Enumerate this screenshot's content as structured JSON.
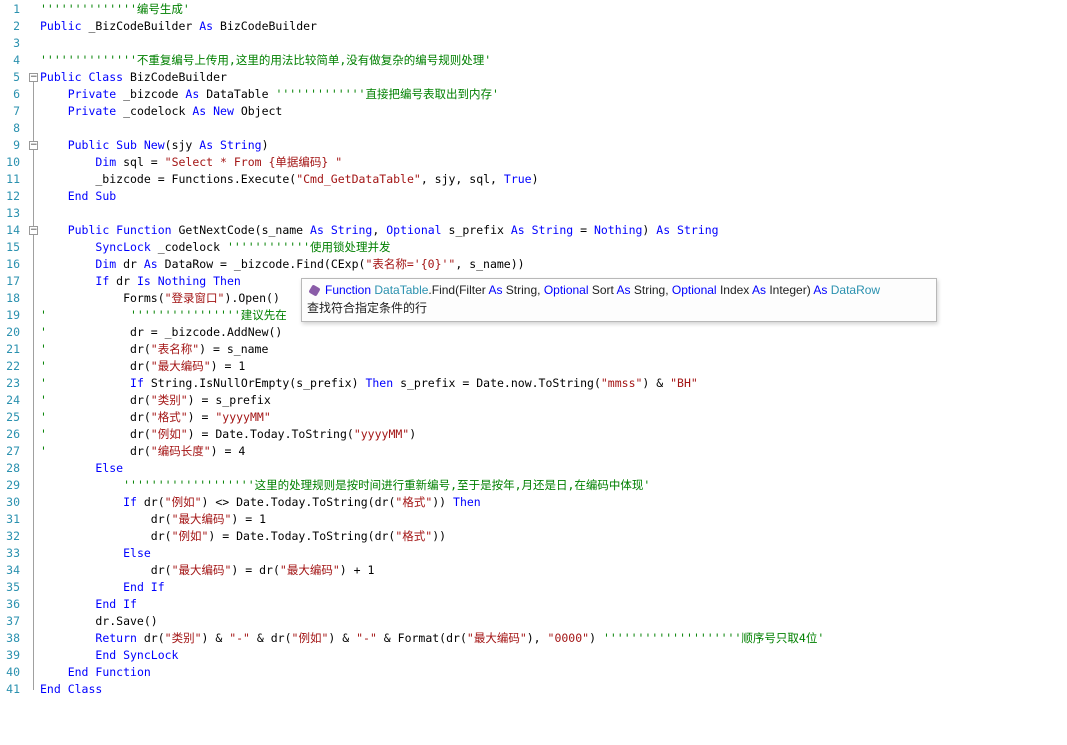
{
  "editor": {
    "lines": [
      {
        "n": "1",
        "fold": "",
        "segs": [
          {
            "c": "c",
            "t": "''''''''''''''编号生成'"
          }
        ]
      },
      {
        "n": "2",
        "fold": "",
        "segs": [
          {
            "c": "k",
            "t": "Public"
          },
          {
            "c": "n",
            "t": " _BizCodeBuilder "
          },
          {
            "c": "k",
            "t": "As"
          },
          {
            "c": "n",
            "t": " BizCodeBuilder"
          }
        ]
      },
      {
        "n": "3",
        "fold": "",
        "segs": []
      },
      {
        "n": "4",
        "fold": "",
        "segs": [
          {
            "c": "c",
            "t": "''''''''''''''不重复编号上传用,这里的用法比较简单,没有做复杂的编号规则处理'"
          }
        ]
      },
      {
        "n": "5",
        "fold": "−",
        "segs": [
          {
            "c": "k",
            "t": "Public Class"
          },
          {
            "c": "n",
            "t": " BizCodeBuilder"
          }
        ]
      },
      {
        "n": "6",
        "fold": "",
        "segs": [
          {
            "c": "n",
            "t": "    "
          },
          {
            "c": "k",
            "t": "Private"
          },
          {
            "c": "n",
            "t": " _bizcode "
          },
          {
            "c": "k",
            "t": "As"
          },
          {
            "c": "n",
            "t": " DataTable "
          },
          {
            "c": "c",
            "t": "'''''''''''''直接把编号表取出到内存'"
          }
        ]
      },
      {
        "n": "7",
        "fold": "",
        "segs": [
          {
            "c": "n",
            "t": "    "
          },
          {
            "c": "k",
            "t": "Private"
          },
          {
            "c": "n",
            "t": " _codelock "
          },
          {
            "c": "k",
            "t": "As New"
          },
          {
            "c": "n",
            "t": " Object"
          }
        ]
      },
      {
        "n": "8",
        "fold": "",
        "segs": []
      },
      {
        "n": "9",
        "fold": "−",
        "segs": [
          {
            "c": "n",
            "t": "    "
          },
          {
            "c": "k",
            "t": "Public Sub New"
          },
          {
            "c": "n",
            "t": "(sjy "
          },
          {
            "c": "k",
            "t": "As String"
          },
          {
            "c": "n",
            "t": ")"
          }
        ]
      },
      {
        "n": "10",
        "fold": "",
        "segs": [
          {
            "c": "n",
            "t": "        "
          },
          {
            "c": "k",
            "t": "Dim"
          },
          {
            "c": "n",
            "t": " sql = "
          },
          {
            "c": "s",
            "t": "\"Select * From {单据编码} \""
          }
        ]
      },
      {
        "n": "11",
        "fold": "",
        "segs": [
          {
            "c": "n",
            "t": "        _bizcode = Functions.Execute("
          },
          {
            "c": "s",
            "t": "\"Cmd_GetDataTable\""
          },
          {
            "c": "n",
            "t": ", sjy, sql, "
          },
          {
            "c": "k",
            "t": "True"
          },
          {
            "c": "n",
            "t": ")"
          }
        ]
      },
      {
        "n": "12",
        "fold": "",
        "segs": [
          {
            "c": "n",
            "t": "    "
          },
          {
            "c": "k",
            "t": "End Sub"
          }
        ]
      },
      {
        "n": "13",
        "fold": "",
        "segs": []
      },
      {
        "n": "14",
        "fold": "−",
        "segs": [
          {
            "c": "n",
            "t": "    "
          },
          {
            "c": "k",
            "t": "Public Function"
          },
          {
            "c": "n",
            "t": " GetNextCode(s_name "
          },
          {
            "c": "k",
            "t": "As String"
          },
          {
            "c": "n",
            "t": ", "
          },
          {
            "c": "k",
            "t": "Optional"
          },
          {
            "c": "n",
            "t": " s_prefix "
          },
          {
            "c": "k",
            "t": "As String"
          },
          {
            "c": "n",
            "t": " = "
          },
          {
            "c": "k",
            "t": "Nothing"
          },
          {
            "c": "n",
            "t": ") "
          },
          {
            "c": "k",
            "t": "As String"
          }
        ]
      },
      {
        "n": "15",
        "fold": "",
        "segs": [
          {
            "c": "n",
            "t": "        "
          },
          {
            "c": "k",
            "t": "SyncLock"
          },
          {
            "c": "n",
            "t": " _codelock "
          },
          {
            "c": "c",
            "t": "''''''''''''使用锁处理并发"
          }
        ]
      },
      {
        "n": "16",
        "fold": "",
        "segs": [
          {
            "c": "n",
            "t": "        "
          },
          {
            "c": "k",
            "t": "Dim"
          },
          {
            "c": "n",
            "t": " dr "
          },
          {
            "c": "k",
            "t": "As"
          },
          {
            "c": "n",
            "t": " DataRow = _bizcode.Find(CExp("
          },
          {
            "c": "s",
            "t": "\"表名称='{0}'\""
          },
          {
            "c": "n",
            "t": ", s_name))"
          }
        ]
      },
      {
        "n": "17",
        "fold": "",
        "segs": [
          {
            "c": "n",
            "t": "        "
          },
          {
            "c": "k",
            "t": "If"
          },
          {
            "c": "n",
            "t": " dr "
          },
          {
            "c": "k",
            "t": "Is Nothing Then"
          }
        ]
      },
      {
        "n": "18",
        "fold": "",
        "segs": [
          {
            "c": "n",
            "t": "            Forms("
          },
          {
            "c": "s",
            "t": "\"登录窗口\""
          },
          {
            "c": "n",
            "t": ").Open()"
          }
        ]
      },
      {
        "n": "19",
        "fold": "",
        "segs": [
          {
            "c": "c",
            "t": "'            ''''''''''''''''建议先在"
          }
        ]
      },
      {
        "n": "20",
        "fold": "",
        "segs": [
          {
            "c": "c",
            "t": "'"
          },
          {
            "c": "n",
            "t": "            dr = _bizcode.AddNew()"
          }
        ]
      },
      {
        "n": "21",
        "fold": "",
        "segs": [
          {
            "c": "c",
            "t": "'"
          },
          {
            "c": "n",
            "t": "            dr("
          },
          {
            "c": "s",
            "t": "\"表名称\""
          },
          {
            "c": "n",
            "t": ") = s_name"
          }
        ]
      },
      {
        "n": "22",
        "fold": "",
        "segs": [
          {
            "c": "c",
            "t": "'"
          },
          {
            "c": "n",
            "t": "            dr("
          },
          {
            "c": "s",
            "t": "\"最大编码\""
          },
          {
            "c": "n",
            "t": ") = 1"
          }
        ]
      },
      {
        "n": "23",
        "fold": "",
        "segs": [
          {
            "c": "c",
            "t": "'"
          },
          {
            "c": "n",
            "t": "            "
          },
          {
            "c": "k",
            "t": "If"
          },
          {
            "c": "n",
            "t": " String.IsNullOrEmpty(s_prefix) "
          },
          {
            "c": "k",
            "t": "Then"
          },
          {
            "c": "n",
            "t": " s_prefix = Date.now.ToString("
          },
          {
            "c": "s",
            "t": "\"mmss\""
          },
          {
            "c": "n",
            "t": ") & "
          },
          {
            "c": "s",
            "t": "\"BH\""
          }
        ]
      },
      {
        "n": "24",
        "fold": "",
        "segs": [
          {
            "c": "c",
            "t": "'"
          },
          {
            "c": "n",
            "t": "            dr("
          },
          {
            "c": "s",
            "t": "\"类别\""
          },
          {
            "c": "n",
            "t": ") = s_prefix"
          }
        ]
      },
      {
        "n": "25",
        "fold": "",
        "segs": [
          {
            "c": "c",
            "t": "'"
          },
          {
            "c": "n",
            "t": "            dr("
          },
          {
            "c": "s",
            "t": "\"格式\""
          },
          {
            "c": "n",
            "t": ") = "
          },
          {
            "c": "s",
            "t": "\"yyyyMM\""
          }
        ]
      },
      {
        "n": "26",
        "fold": "",
        "segs": [
          {
            "c": "c",
            "t": "'"
          },
          {
            "c": "n",
            "t": "            dr("
          },
          {
            "c": "s",
            "t": "\"例如\""
          },
          {
            "c": "n",
            "t": ") = Date.Today.ToString("
          },
          {
            "c": "s",
            "t": "\"yyyyMM\""
          },
          {
            "c": "n",
            "t": ")"
          }
        ]
      },
      {
        "n": "27",
        "fold": "",
        "segs": [
          {
            "c": "c",
            "t": "'"
          },
          {
            "c": "n",
            "t": "            dr("
          },
          {
            "c": "s",
            "t": "\"编码长度\""
          },
          {
            "c": "n",
            "t": ") = 4"
          }
        ]
      },
      {
        "n": "28",
        "fold": "",
        "segs": [
          {
            "c": "n",
            "t": "        "
          },
          {
            "c": "k",
            "t": "Else"
          }
        ]
      },
      {
        "n": "29",
        "fold": "",
        "segs": [
          {
            "c": "n",
            "t": "            "
          },
          {
            "c": "c",
            "t": "'''''''''''''''''''这里的处理规则是按时间进行重新编号,至于是按年,月还是日,在编码中体现'"
          }
        ]
      },
      {
        "n": "30",
        "fold": "",
        "segs": [
          {
            "c": "n",
            "t": "            "
          },
          {
            "c": "k",
            "t": "If"
          },
          {
            "c": "n",
            "t": " dr("
          },
          {
            "c": "s",
            "t": "\"例如\""
          },
          {
            "c": "n",
            "t": ") <> Date.Today.ToString(dr("
          },
          {
            "c": "s",
            "t": "\"格式\""
          },
          {
            "c": "n",
            "t": ")) "
          },
          {
            "c": "k",
            "t": "Then"
          }
        ]
      },
      {
        "n": "31",
        "fold": "",
        "segs": [
          {
            "c": "n",
            "t": "                dr("
          },
          {
            "c": "s",
            "t": "\"最大编码\""
          },
          {
            "c": "n",
            "t": ") = 1"
          }
        ]
      },
      {
        "n": "32",
        "fold": "",
        "segs": [
          {
            "c": "n",
            "t": "                dr("
          },
          {
            "c": "s",
            "t": "\"例如\""
          },
          {
            "c": "n",
            "t": ") = Date.Today.ToString(dr("
          },
          {
            "c": "s",
            "t": "\"格式\""
          },
          {
            "c": "n",
            "t": "))"
          }
        ]
      },
      {
        "n": "33",
        "fold": "",
        "segs": [
          {
            "c": "n",
            "t": "            "
          },
          {
            "c": "k",
            "t": "Else"
          }
        ]
      },
      {
        "n": "34",
        "fold": "",
        "segs": [
          {
            "c": "n",
            "t": "                dr("
          },
          {
            "c": "s",
            "t": "\"最大编码\""
          },
          {
            "c": "n",
            "t": ") = dr("
          },
          {
            "c": "s",
            "t": "\"最大编码\""
          },
          {
            "c": "n",
            "t": ") + 1"
          }
        ]
      },
      {
        "n": "35",
        "fold": "",
        "segs": [
          {
            "c": "n",
            "t": "            "
          },
          {
            "c": "k",
            "t": "End If"
          }
        ]
      },
      {
        "n": "36",
        "fold": "",
        "segs": [
          {
            "c": "n",
            "t": "        "
          },
          {
            "c": "k",
            "t": "End If"
          }
        ]
      },
      {
        "n": "37",
        "fold": "",
        "segs": [
          {
            "c": "n",
            "t": "        dr.Save()"
          }
        ]
      },
      {
        "n": "38",
        "fold": "",
        "segs": [
          {
            "c": "n",
            "t": "        "
          },
          {
            "c": "k",
            "t": "Return"
          },
          {
            "c": "n",
            "t": " dr("
          },
          {
            "c": "s",
            "t": "\"类别\""
          },
          {
            "c": "n",
            "t": ") & "
          },
          {
            "c": "s",
            "t": "\"-\""
          },
          {
            "c": "n",
            "t": " & dr("
          },
          {
            "c": "s",
            "t": "\"例如\""
          },
          {
            "c": "n",
            "t": ") & "
          },
          {
            "c": "s",
            "t": "\"-\""
          },
          {
            "c": "n",
            "t": " & Format(dr("
          },
          {
            "c": "s",
            "t": "\"最大编码\""
          },
          {
            "c": "n",
            "t": "), "
          },
          {
            "c": "s",
            "t": "\"0000\""
          },
          {
            "c": "n",
            "t": ") "
          },
          {
            "c": "c",
            "t": "''''''''''''''''''''顺序号只取4位'"
          }
        ]
      },
      {
        "n": "39",
        "fold": "",
        "segs": [
          {
            "c": "n",
            "t": "        "
          },
          {
            "c": "k",
            "t": "End SyncLock"
          }
        ]
      },
      {
        "n": "40",
        "fold": "",
        "segs": [
          {
            "c": "n",
            "t": "    "
          },
          {
            "c": "k",
            "t": "End Function"
          }
        ]
      },
      {
        "n": "41",
        "fold": "",
        "segs": [
          {
            "c": "k",
            "t": "End Class"
          }
        ]
      }
    ]
  },
  "tooltip": {
    "icon": "method-cube-icon",
    "kw_function": "Function",
    "type_datatable": "DataTable",
    "find": ".Find(Filter ",
    "as1": "As",
    "string1": " String, ",
    "optional": "Optional",
    "sort": " Sort ",
    "as2": "As",
    "string2": " String, ",
    "optional2": "Optional",
    "index": " Index ",
    "as3": "As",
    "integer": " Integer) ",
    "as4": "As",
    "type_datarow": " DataRow",
    "description": "查找符合指定条件的行"
  },
  "colors": {
    "keyword": "#0000ff",
    "comment": "#008000",
    "string": "#a31515",
    "line_number": "#2b91af"
  }
}
